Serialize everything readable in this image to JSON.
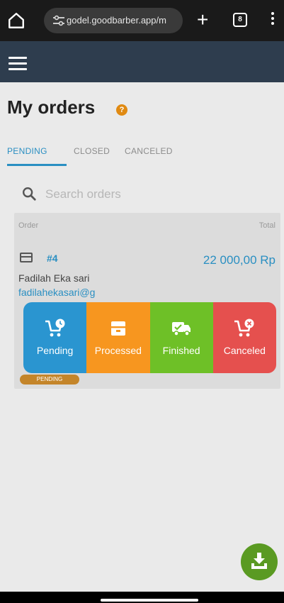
{
  "browser": {
    "url": "godel.goodbarber.app/m",
    "new_tab_glyph": "+",
    "tab_count": "8",
    "home_icon": "home-icon",
    "menu_icon": "kebab-menu-icon"
  },
  "app_header": {
    "menu_icon": "hamburger-icon",
    "background": "#2e3d4e"
  },
  "page": {
    "title": "My orders",
    "help_glyph": "?"
  },
  "tabs": [
    {
      "label": "PENDING",
      "active": true
    },
    {
      "label": "CLOSED",
      "active": false
    },
    {
      "label": "CANCELED",
      "active": false
    }
  ],
  "search": {
    "placeholder": "Search orders",
    "icon": "search-icon"
  },
  "order_list": {
    "header_order": "Order",
    "header_total": "Total",
    "orders": [
      {
        "number": "#4",
        "total": "22 000,00 Rp",
        "customer_name": "Fadilah Eka sari",
        "customer_email": "fadilahekasari@g",
        "status_chip": "PENDING"
      }
    ]
  },
  "status_options": [
    {
      "label": "Pending",
      "icon": "cart-clock-icon",
      "color": "#2a95d0"
    },
    {
      "label": "Processed",
      "icon": "package-icon",
      "color": "#f7961f"
    },
    {
      "label": "Finished",
      "icon": "delivery-truck-icon",
      "color": "#6ec027"
    },
    {
      "label": "Canceled",
      "icon": "cart-cancel-icon",
      "color": "#e5504e"
    }
  ],
  "fab": {
    "icon": "download-icon",
    "color": "#5a9a22"
  },
  "colors": {
    "accent": "#2a8fc2",
    "page_bg": "#eaeaea"
  }
}
